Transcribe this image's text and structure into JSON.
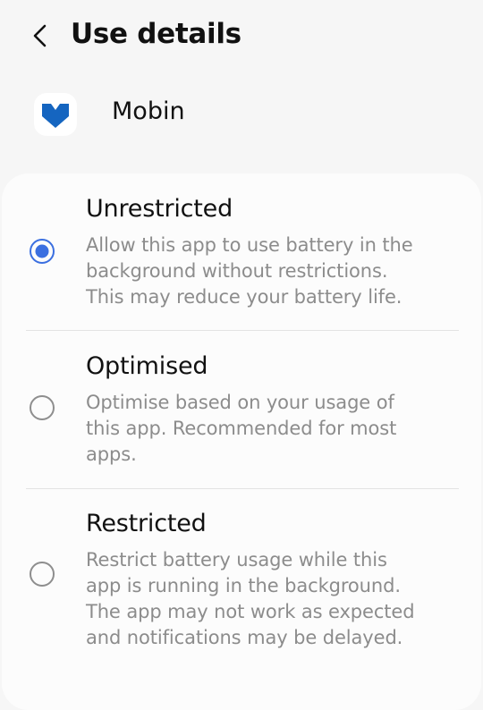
{
  "header": {
    "back_icon": "chevron-left-icon",
    "title": "Use details"
  },
  "app": {
    "icon": "mobin-app-icon",
    "name": "Mobin",
    "icon_color": "#1565c0"
  },
  "battery_options": {
    "selected": "Unrestricted",
    "accent_color": "#3b6fe0",
    "items": [
      {
        "title": "Unrestricted",
        "checked": true,
        "description_lines": [
          "Allow this app to use battery in the",
          "background without restrictions.",
          "This may reduce your battery life."
        ]
      },
      {
        "title": "Optimised",
        "checked": false,
        "description_lines": [
          "Optimise based on your usage of",
          "this app. Recommended for most",
          "apps."
        ]
      },
      {
        "title": "Restricted",
        "checked": false,
        "description_lines": [
          "Restrict battery usage while this",
          "app is running in the background.",
          "The app may not work as expected",
          "and notifications may be delayed."
        ]
      }
    ]
  }
}
